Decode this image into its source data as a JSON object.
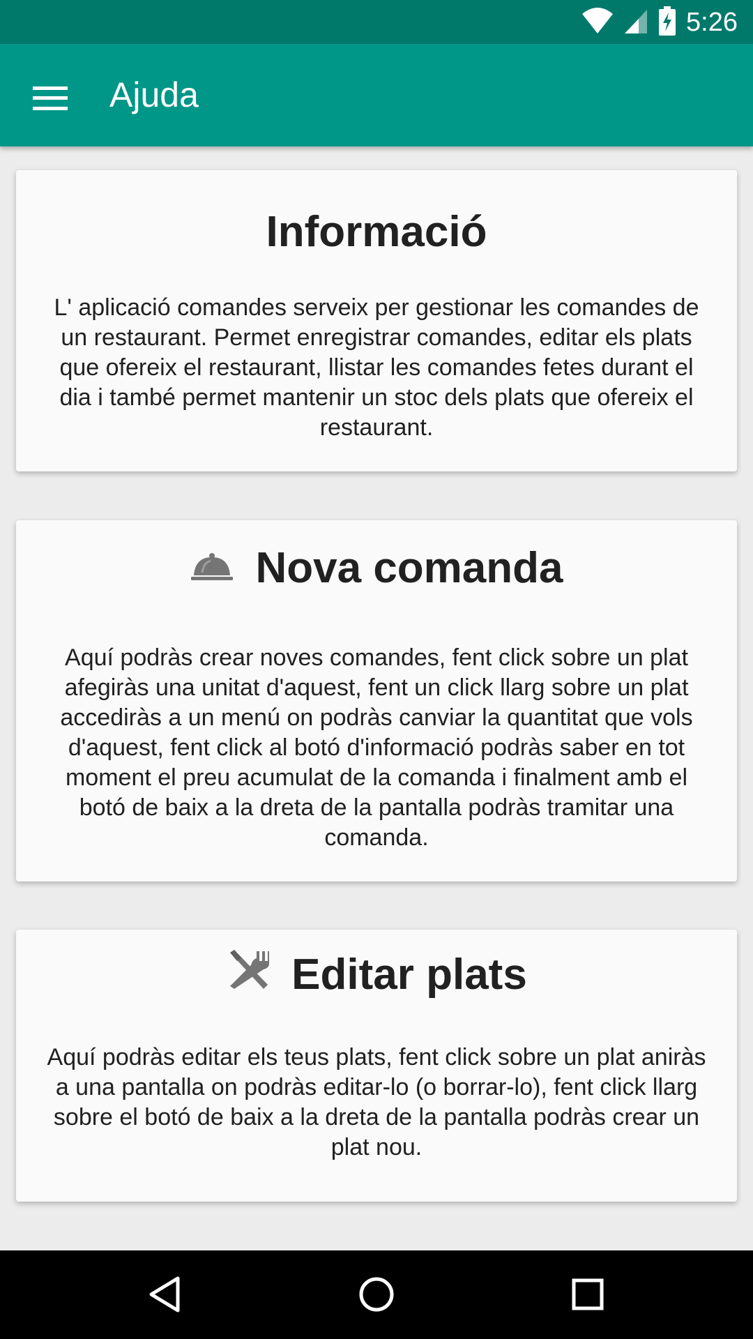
{
  "status_bar": {
    "time": "5:26",
    "icons": [
      "wifi-icon",
      "cell-signal-icon",
      "battery-charging-icon"
    ]
  },
  "app_bar": {
    "title": "Ajuda",
    "menu_icon": "hamburger-menu-icon"
  },
  "cards": [
    {
      "title": "Informació",
      "icon": null,
      "body": "L' aplicació comandes serveix per gestionar les comandes de un restaurant. Permet enregistrar comandes, editar els plats que ofereix el restaurant, llistar les comandes fetes durant el dia i també permet mantenir un stoc dels plats que ofereix el restaurant."
    },
    {
      "title": "Nova comanda",
      "icon": "cloche-icon",
      "body": "Aquí podràs crear noves comandes, fent click sobre un plat afegiràs una unitat d'aquest, fent un click llarg sobre un plat accediràs a un menú on podràs canviar la quantitat que vols d'aquest, fent click al botó d'informació podràs saber en tot moment el preu acumulat de la comanda i finalment amb el botó de baix a la dreta de la pantalla podràs tramitar una comanda."
    },
    {
      "title": "Editar plats",
      "icon": "cutlery-icon",
      "body": "Aquí podràs editar els teus plats, fent click sobre un plat aniràs a una pantalla on podràs editar-lo (o borrar-lo), fent click llarg sobre el botó de baix a la dreta de la pantalla podràs crear un plat nou."
    }
  ],
  "nav_bar": {
    "buttons": [
      "back-icon",
      "home-icon",
      "recents-icon"
    ]
  },
  "colors": {
    "status_bar": "#00796b",
    "app_bar": "#009688",
    "card_bg": "#fafafa",
    "page_bg": "#ececec",
    "icon_gray": "#757575"
  }
}
